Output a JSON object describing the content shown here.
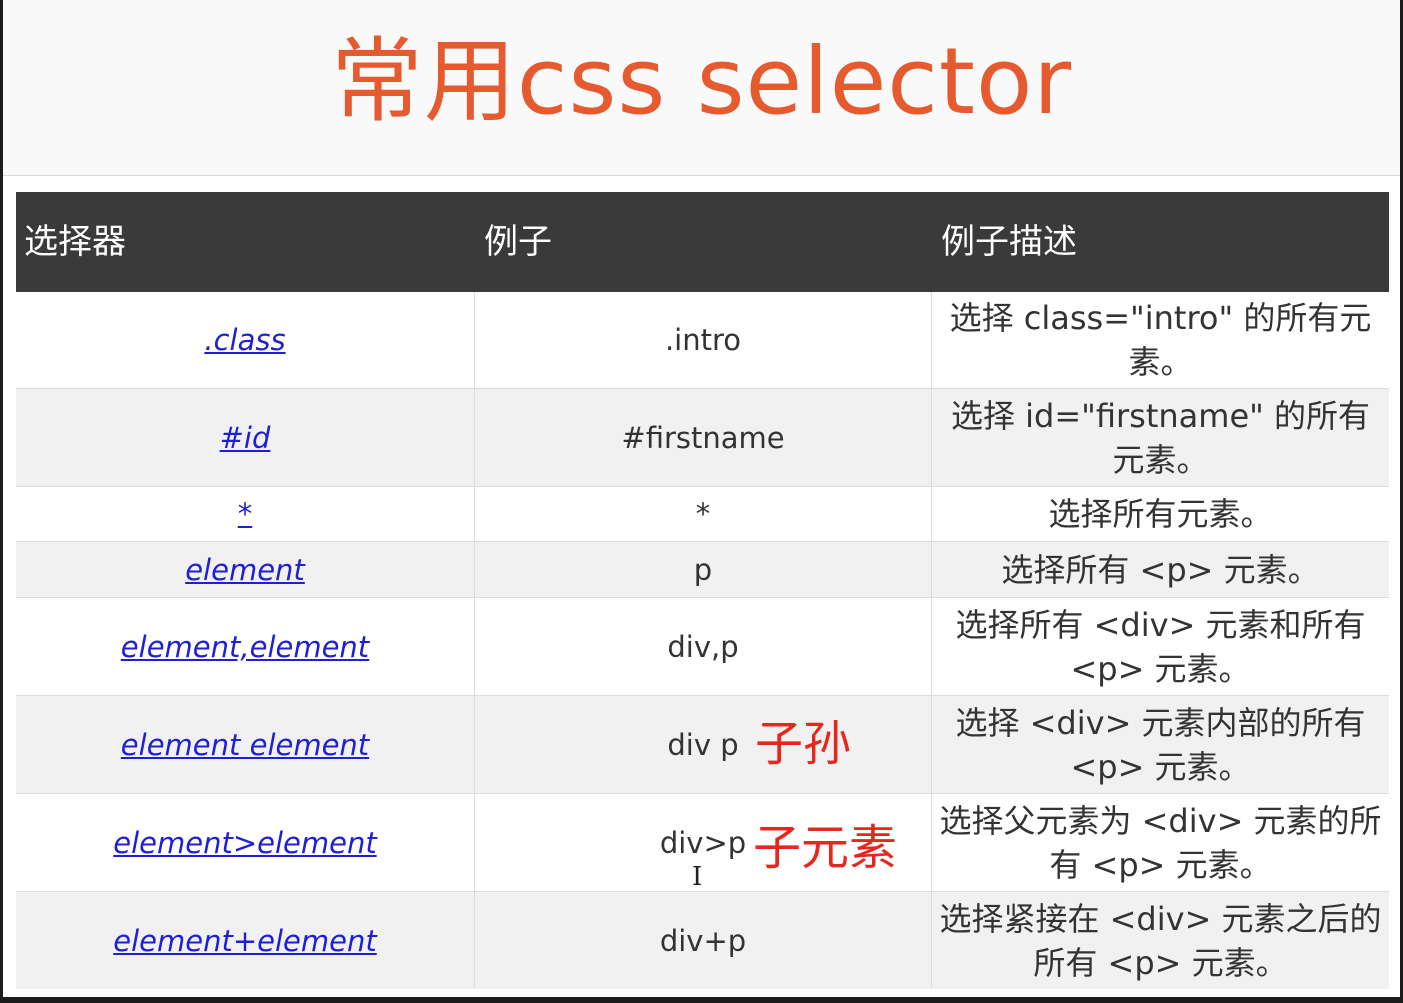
{
  "title": "常用css selector",
  "table": {
    "headers": [
      "选择器",
      "例子",
      "例子描述"
    ],
    "rows": [
      {
        "selector": ".class",
        "example": ".intro",
        "description": "选择 class=\"intro\" 的所有元素。"
      },
      {
        "selector": "#id",
        "example": "#firstname",
        "description": "选择 id=\"firstname\" 的所有元素。"
      },
      {
        "selector": "*",
        "example": "*",
        "description": "选择所有元素。"
      },
      {
        "selector": "element",
        "example": "p",
        "description": "选择所有 <p> 元素。"
      },
      {
        "selector": "element,element",
        "example": "div,p",
        "description": "选择所有 <div> 元素和所有 <p> 元素。"
      },
      {
        "selector": "element element",
        "example": "div p",
        "description": "选择 <div> 元素内部的所有 <p> 元素。"
      },
      {
        "selector": "element>element",
        "example": "div>p",
        "description": "选择父元素为 <div> 元素的所有 <p> 元素。"
      },
      {
        "selector": "element+element",
        "example": "div+p",
        "description": "选择紧接在 <div> 元素之后的所有 <p> 元素。"
      }
    ]
  },
  "annotations": {
    "descendant": "子孙",
    "child": "子元素"
  },
  "colors": {
    "title": "#e55a2e",
    "header_bg": "#3a3a3a",
    "link": "#1f1fd6",
    "annotation": "#e5271e"
  },
  "icons": {
    "cursor": "text-cursor-icon"
  }
}
